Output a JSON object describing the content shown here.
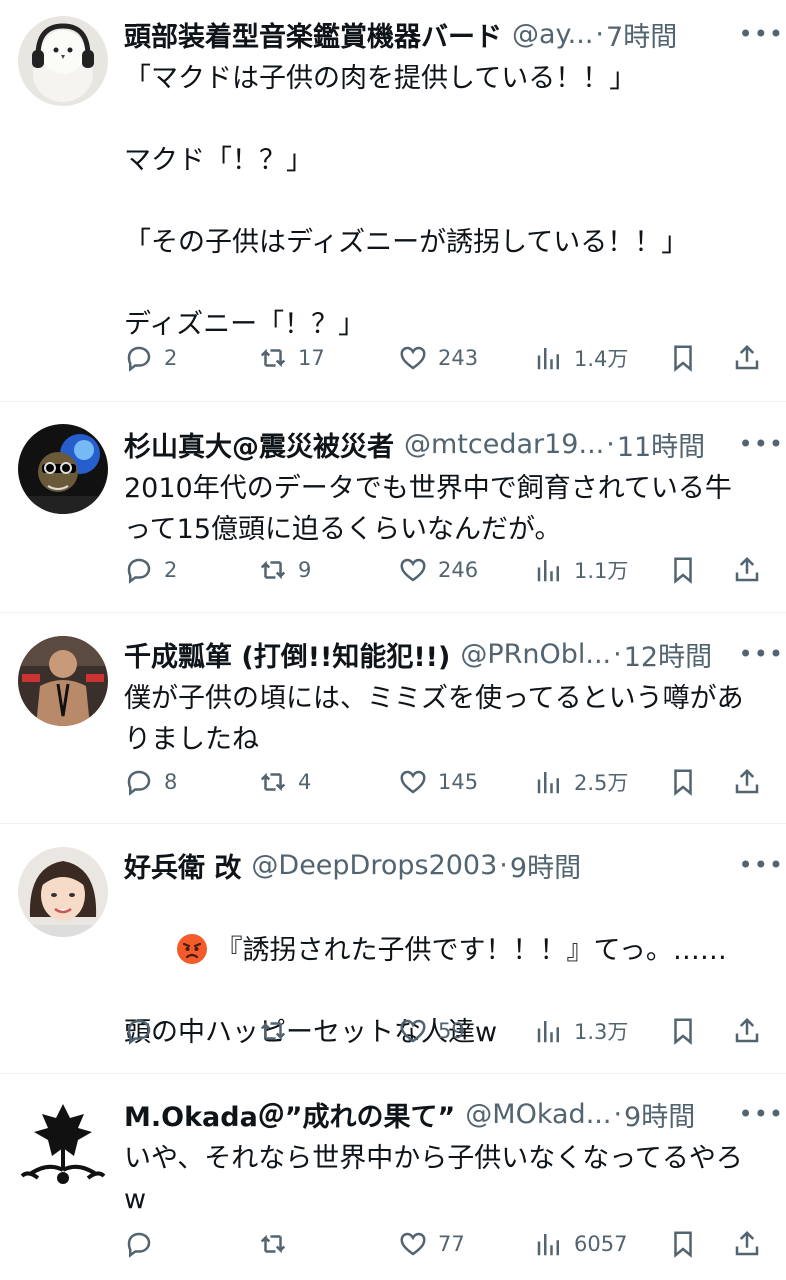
{
  "tweets": [
    {
      "name": "頭部装着型音楽鑑賞機器バード",
      "handle": "@ay...",
      "time": "7時間",
      "text": "「マクドは子供の肉を提供している！！」\n\nマクド「！？」\n\n「その子供はディズニーが誘拐している！！」\n\nディズニー「！？」",
      "replies": "2",
      "retweets": "17",
      "likes": "243",
      "views": "1.4万"
    },
    {
      "name": "杉山真大@震災被災者",
      "handle": "@mtcedar19...",
      "time": "11時間",
      "text": "2010年代のデータでも世界中で飼育されている牛って15億頭に迫るくらいなんだが。",
      "replies": "2",
      "retweets": "9",
      "likes": "246",
      "views": "1.1万"
    },
    {
      "name": "千成瓢箪 (打倒!!知能犯!!)",
      "handle": "@PRnObl...",
      "time": "12時間",
      "text": "僕が子供の頃には、ミミズを使ってるという噂がありましたね",
      "replies": "8",
      "retweets": "4",
      "likes": "145",
      "views": "2.5万"
    },
    {
      "name": "好兵衛 改",
      "handle": "@DeepDrops2003",
      "time": "9時間",
      "emoji": "angry-face-icon",
      "text": "『誘拐された子供です！！！』てっ。……\n\n頭の中ハッピーセットな人達w",
      "replies": "",
      "retweets": "",
      "likes": "59",
      "views": "1.3万"
    },
    {
      "name": "M.Okada＠”成れの果て”",
      "handle": "@MOkad...",
      "time": "9時間",
      "text": "いや、それなら世界中から子供いなくなってるやろw",
      "replies": "",
      "retweets": "",
      "likes": "77",
      "views": "6057"
    }
  ],
  "icons": {
    "more": "more-icon",
    "reply": "reply-icon",
    "retweet": "retweet-icon",
    "like": "heart-icon",
    "views": "views-icon",
    "bookmark": "bookmark-icon",
    "share": "share-icon"
  },
  "more_glyph": "•••",
  "dot": "·",
  "colors": {
    "text": "#0f1419",
    "secondary": "#536471",
    "divider": "#eff3f4"
  }
}
